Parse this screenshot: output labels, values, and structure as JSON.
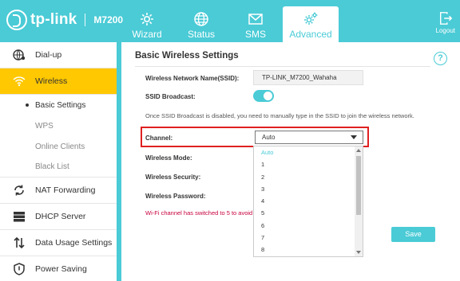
{
  "brand": {
    "name": "tp-link",
    "model": "M7200"
  },
  "nav": {
    "tabs": [
      {
        "label": "Wizard"
      },
      {
        "label": "Status"
      },
      {
        "label": "SMS"
      },
      {
        "label": "Advanced"
      }
    ],
    "logout_label": "Logout"
  },
  "sidebar": {
    "items": [
      {
        "label": "Dial-up",
        "icon": "globe-settings-icon"
      },
      {
        "label": "Wireless",
        "icon": "wifi-icon"
      },
      {
        "label": "NAT Forwarding",
        "icon": "cycle-icon"
      },
      {
        "label": "DHCP Server",
        "icon": "server-icon"
      },
      {
        "label": "Data Usage Settings",
        "icon": "updown-arrows-icon"
      },
      {
        "label": "Power Saving",
        "icon": "shield-icon"
      }
    ],
    "wireless_sub": [
      "Basic Settings",
      "WPS",
      "Online Clients",
      "Black List"
    ]
  },
  "main": {
    "title": "Basic Wireless Settings",
    "ssid_label": "Wireless Network Name(SSID):",
    "ssid_value": "TP-LINK_M7200_Wahaha",
    "broadcast_label": "SSID Broadcast:",
    "broadcast_note": "Once SSID Broadcast is disabled, you need to manually type in the SSID to join the wireless network.",
    "channel_label": "Channel:",
    "channel_value": "Auto",
    "mode_label": "Wireless Mode:",
    "security_label": "Wireless Security:",
    "password_label": "Wireless Password:",
    "warning": "Wi-Fi channel has switched to 5 to avoid in",
    "save_label": "Save",
    "channel_options": [
      "Auto",
      "1",
      "2",
      "3",
      "4",
      "5",
      "6",
      "7",
      "8"
    ]
  },
  "colors": {
    "accent": "#4ACBD6",
    "active": "#FFC800",
    "alert": "#E02020"
  }
}
